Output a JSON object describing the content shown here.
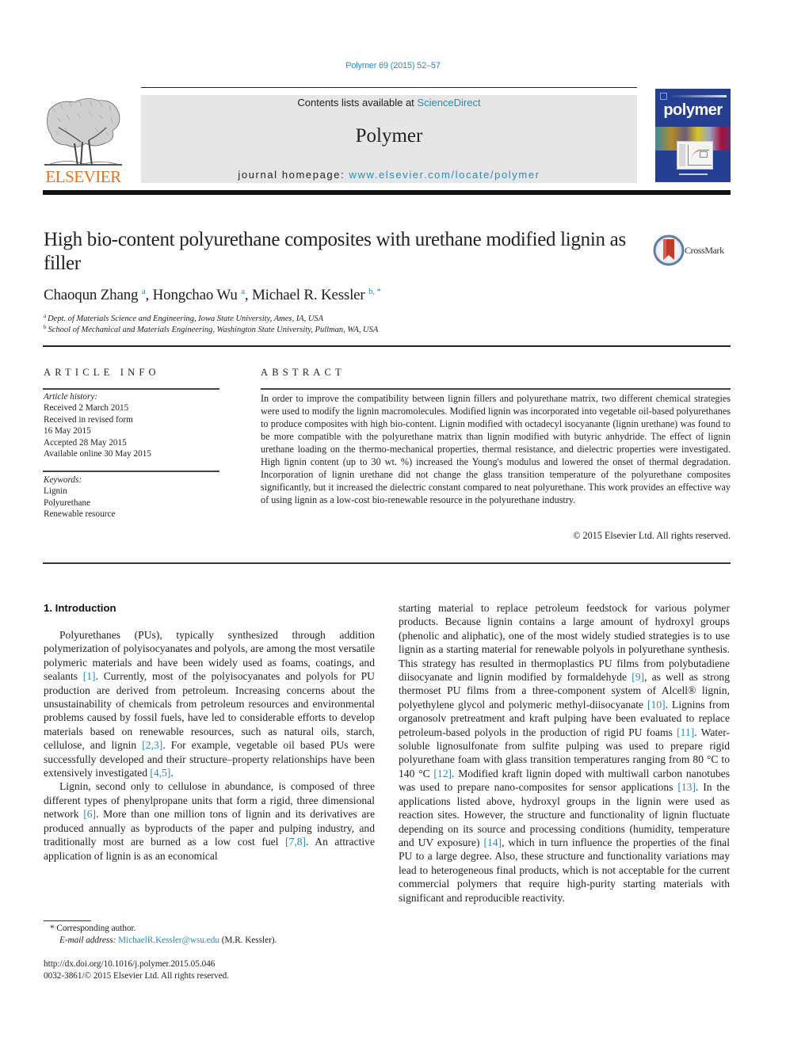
{
  "header": {
    "citation": "Polymer 69 (2015) 52–57",
    "contents_prefix": "Contents lists available at ",
    "contents_link": "ScienceDirect",
    "journal_name": "Polymer",
    "homepage_prefix": "journal homepage: ",
    "homepage_link": "www.elsevier.com/locate/polymer",
    "publisher_logo_text": "ELSEVIER",
    "cover_title": "polymer",
    "colors": {
      "link": "#2b8ab8",
      "elsevier_orange": "#e9711c",
      "cover_blue": "#253f92",
      "masthead_bg": "#e6e6e6"
    }
  },
  "article": {
    "title": "High bio-content polyurethane composites with urethane modified lignin as filler",
    "crossmark_label": "CrossMark",
    "authors": [
      {
        "name": "Chaoqun Zhang",
        "sup": "a"
      },
      {
        "name": "Hongchao Wu",
        "sup": "a"
      },
      {
        "name": "Michael R. Kessler",
        "sup": "b, *"
      }
    ],
    "affiliations": [
      {
        "key": "a",
        "text": "Dept. of Materials Science and Engineering, Iowa State University, Ames, IA, USA"
      },
      {
        "key": "b",
        "text": "School of Mechanical and Materials Engineering, Washington State University, Pullman, WA, USA"
      }
    ]
  },
  "article_info": {
    "heading": "ARTICLE INFO",
    "history_label": "Article history:",
    "history": [
      "Received 2 March 2015",
      "Received in revised form",
      "16 May 2015",
      "Accepted 28 May 2015",
      "Available online 30 May 2015"
    ],
    "keywords_label": "Keywords:",
    "keywords": [
      "Lignin",
      "Polyurethane",
      "Renewable resource"
    ]
  },
  "abstract": {
    "heading": "ABSTRACT",
    "text": "In order to improve the compatibility between lignin fillers and polyurethane matrix, two different chemical strategies were used to modify the lignin macromolecules. Modified lignin was incorporated into vegetable oil-based polyurethanes to produce composites with high bio-content. Lignin modified with octadecyl isocyanante (lignin urethane) was found to be more compatible with the polyurethane matrix than lignin modified with butyric anhydride. The effect of lignin urethane loading on the thermo-mechanical properties, thermal resistance, and dielectric properties were investigated. High lignin content (up to 30 wt. %) increased the Young's modulus and lowered the onset of thermal degradation. Incorporation of lignin urethane did not change the glass transition temperature of the polyurethane composites significantly, but it increased the dielectric constant compared to neat polyurethane. This work provides an effective way of using lignin as a low-cost bio-renewable resource in the polyurethane industry.",
    "copyright": "© 2015 Elsevier Ltd. All rights reserved."
  },
  "body": {
    "section_heading": "1.  Introduction",
    "left_paragraphs": [
      [
        {
          "t": "Polyurethanes (PUs), typically synthesized through addition polymerization of polyisocyanates and polyols, are among the most versatile polymeric materials and have been widely used as foams, coatings, and sealants "
        },
        {
          "ref": "[1]"
        },
        {
          "t": ". Currently, most of the polyisocyanates and polyols for PU production are derived from petroleum. Increasing concerns about the unsustainability of chemicals from petroleum resources and environmental problems caused by fossil fuels, have led to considerable efforts to develop materials based on renewable resources, such as natural oils, starch, cellulose, and lignin "
        },
        {
          "ref": "[2,3]"
        },
        {
          "t": ". For example, vegetable oil based PUs were successfully developed and their structure–property relationships have been extensively investigated "
        },
        {
          "ref": "[4,5]"
        },
        {
          "t": "."
        }
      ],
      [
        {
          "t": "Lignin, second only to cellulose in abundance, is composed of three different types of phenylpropane units that form a rigid, three dimensional network "
        },
        {
          "ref": "[6]"
        },
        {
          "t": ". More than one million tons of lignin and its derivatives are produced annually as byproducts of the paper and pulping industry, and traditionally most are burned as a low cost fuel "
        },
        {
          "ref": "[7,8]"
        },
        {
          "t": ". An attractive application of lignin is as an economical"
        }
      ]
    ],
    "right_paragraphs": [
      [
        {
          "t": "starting material to replace petroleum feedstock for various polymer products. Because lignin contains a large amount of hydroxyl groups (phenolic and aliphatic), one of the most widely studied strategies is to use lignin as a starting material for renewable polyols in polyurethane synthesis. This strategy has resulted in thermoplastics PU films from polybutadiene diisocyanate and lignin modified by formaldehyde "
        },
        {
          "ref": "[9]"
        },
        {
          "t": ", as well as strong thermoset PU films from a three-component system of Alcell® lignin, polyethylene glycol and polymeric methyl-diisocyanate "
        },
        {
          "ref": "[10]"
        },
        {
          "t": ". Lignins from organosolv pretreatment and kraft pulping have been evaluated to replace petroleum-based polyols in the production of rigid PU foams "
        },
        {
          "ref": "[11]"
        },
        {
          "t": ". Water-soluble lignosulfonate from sulfite pulping was used to prepare rigid polyurethane foam with glass transition temperatures ranging from 80 °C to 140 °C "
        },
        {
          "ref": "[12]"
        },
        {
          "t": ". Modified kraft lignin doped with multiwall carbon nanotubes was used to prepare nano-composites for sensor applications "
        },
        {
          "ref": "[13]"
        },
        {
          "t": ". In the applications listed above, hydroxyl groups in the lignin were used as reaction sites. However, the structure and functionality of lignin fluctuate depending on its source and processing conditions (humidity, temperature and UV exposure) "
        },
        {
          "ref": "[14]"
        },
        {
          "t": ", which in turn influence the properties of the final PU to a large degree. Also, these structure and functionality variations may lead to heterogeneous final products, which is not acceptable for the current commercial polymers that require high-purity starting materials with significant and reproducible reactivity."
        }
      ]
    ]
  },
  "footnotes": {
    "corresponding": "*  Corresponding author.",
    "email_label": "E-mail address: ",
    "email": "MichaelR.Kessler@wsu.edu",
    "email_suffix": " (M.R. Kessler).",
    "doi": "http://dx.doi.org/10.1016/j.polymer.2015.05.046",
    "issn_line": "0032-3861/© 2015 Elsevier Ltd. All rights reserved."
  }
}
